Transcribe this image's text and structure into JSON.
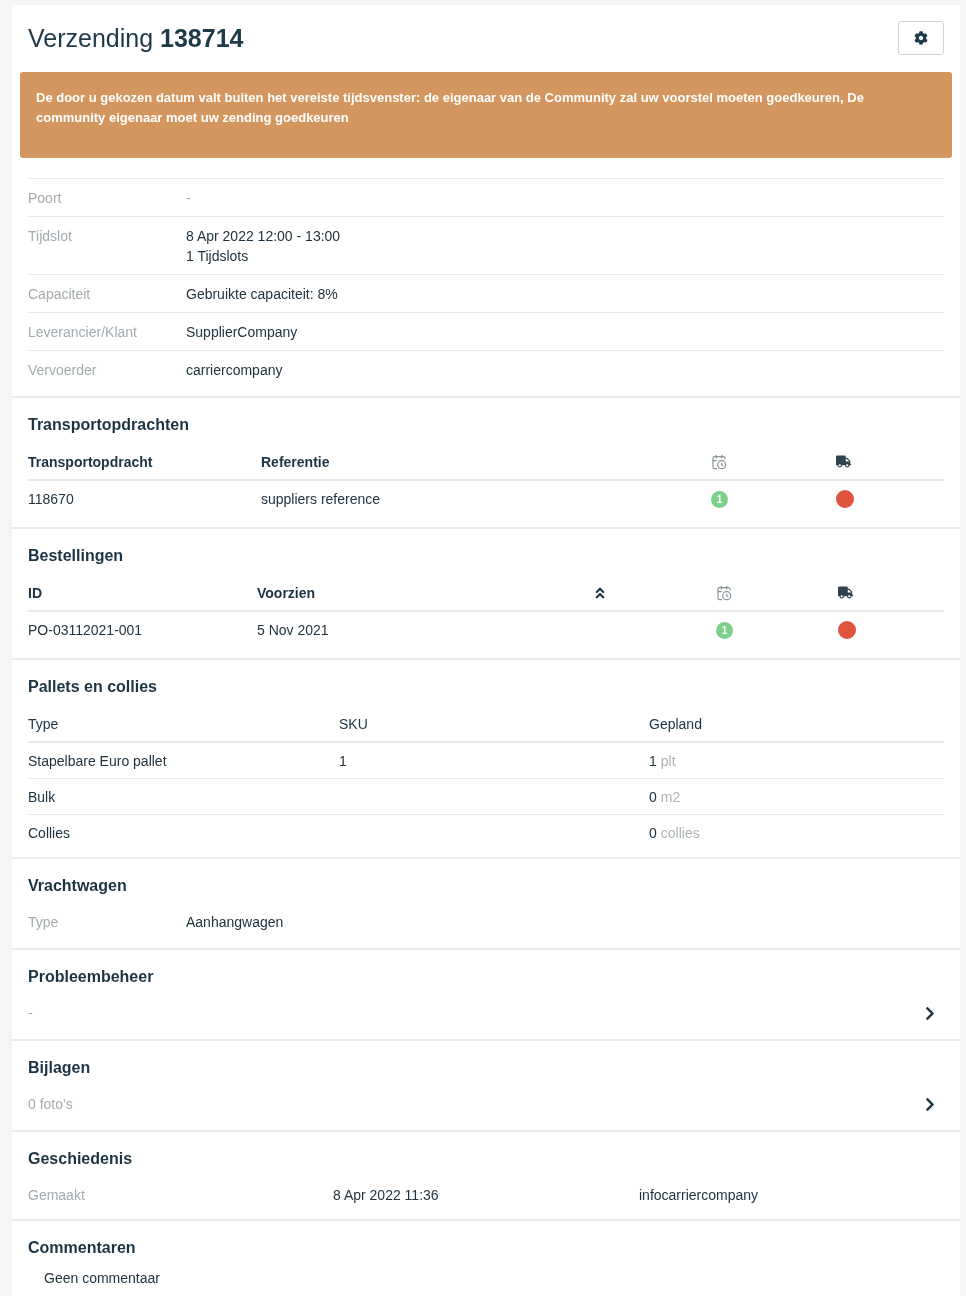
{
  "header": {
    "title": "Verzending **138714**"
  },
  "alert": {
    "message": "De door u gekozen datum valt buiten het vereiste tijdsvenster: de eigenaar van de Community zal uw voorstel moeten goedkeuren, De community eigenaar moet uw zending goedkeuren"
  },
  "details": [
    {
      "label": "Poort",
      "values": [
        "-"
      ],
      "muted": true
    },
    {
      "label": "Tijdslot",
      "values": [
        "8 Apr 2022 12:00 - 13:00",
        "1 Tijdslots"
      ],
      "muted": false
    },
    {
      "label": "Capaciteit",
      "values": [
        "Gebruikte capaciteit: 8%"
      ],
      "muted": false
    },
    {
      "label": "Leverancier/Klant",
      "values": [
        "SupplierCompany"
      ],
      "muted": false
    },
    {
      "label": "Vervoerder",
      "values": [
        "carriercompany"
      ],
      "muted": false
    }
  ],
  "transport_orders": {
    "title": "Transportopdrachten",
    "columns": [
      {
        "kind": "text",
        "label": "Transportopdracht"
      },
      {
        "kind": "text",
        "label": "Referentie"
      },
      {
        "kind": "schedule"
      },
      {
        "kind": "transport"
      }
    ],
    "rows": [
      {
        "cells": [
          {
            "kind": "text",
            "value": "118670"
          },
          {
            "kind": "text",
            "value": "suppliers reference"
          },
          {
            "kind": "count",
            "value": "1",
            "color": "#7dd08a"
          },
          {
            "kind": "dot",
            "color": "#e0533f"
          }
        ]
      }
    ]
  },
  "orders": {
    "title": "Bestellingen",
    "columns": [
      {
        "kind": "text",
        "label": "ID"
      },
      {
        "kind": "text",
        "label": "Voorzien"
      },
      {
        "kind": "sort"
      },
      {
        "kind": "schedule"
      },
      {
        "kind": "transport"
      }
    ],
    "rows": [
      {
        "cells": [
          {
            "kind": "text",
            "value": "PO-03112021-001"
          },
          {
            "kind": "text",
            "value": "5 Nov 2021"
          },
          {
            "kind": "blank"
          },
          {
            "kind": "count",
            "value": "1",
            "color": "#7dd08a"
          },
          {
            "kind": "dot",
            "color": "#e0533f"
          }
        ]
      }
    ]
  },
  "pallets": {
    "title": "Pallets en collies",
    "columns": [
      "Type",
      "SKU",
      "Gepland"
    ],
    "rows": [
      {
        "type": "Stapelbare Euro pallet",
        "sku": "1",
        "amount": "1",
        "unit": "plt"
      },
      {
        "type": "Bulk",
        "amount": "0",
        "unit": "m2"
      },
      {
        "type": "Collies",
        "amount": "0",
        "unit": "collies"
      }
    ]
  },
  "truck": {
    "title": "Vrachtwagen",
    "label": "Type",
    "value": "Aanhangwagen"
  },
  "problems": {
    "title": "Probleembeheer",
    "summary": "-"
  },
  "attachments": {
    "title": "Bijlagen",
    "summary": "0 foto's"
  },
  "history": {
    "title": "Geschiedenis",
    "entries": [
      {
        "action": "Gemaakt",
        "date": "8 Apr 2022 11:36",
        "user": "infocarriercompany"
      }
    ]
  },
  "comments": {
    "title": "Commentaren",
    "empty_text": "Geen commentaar"
  }
}
